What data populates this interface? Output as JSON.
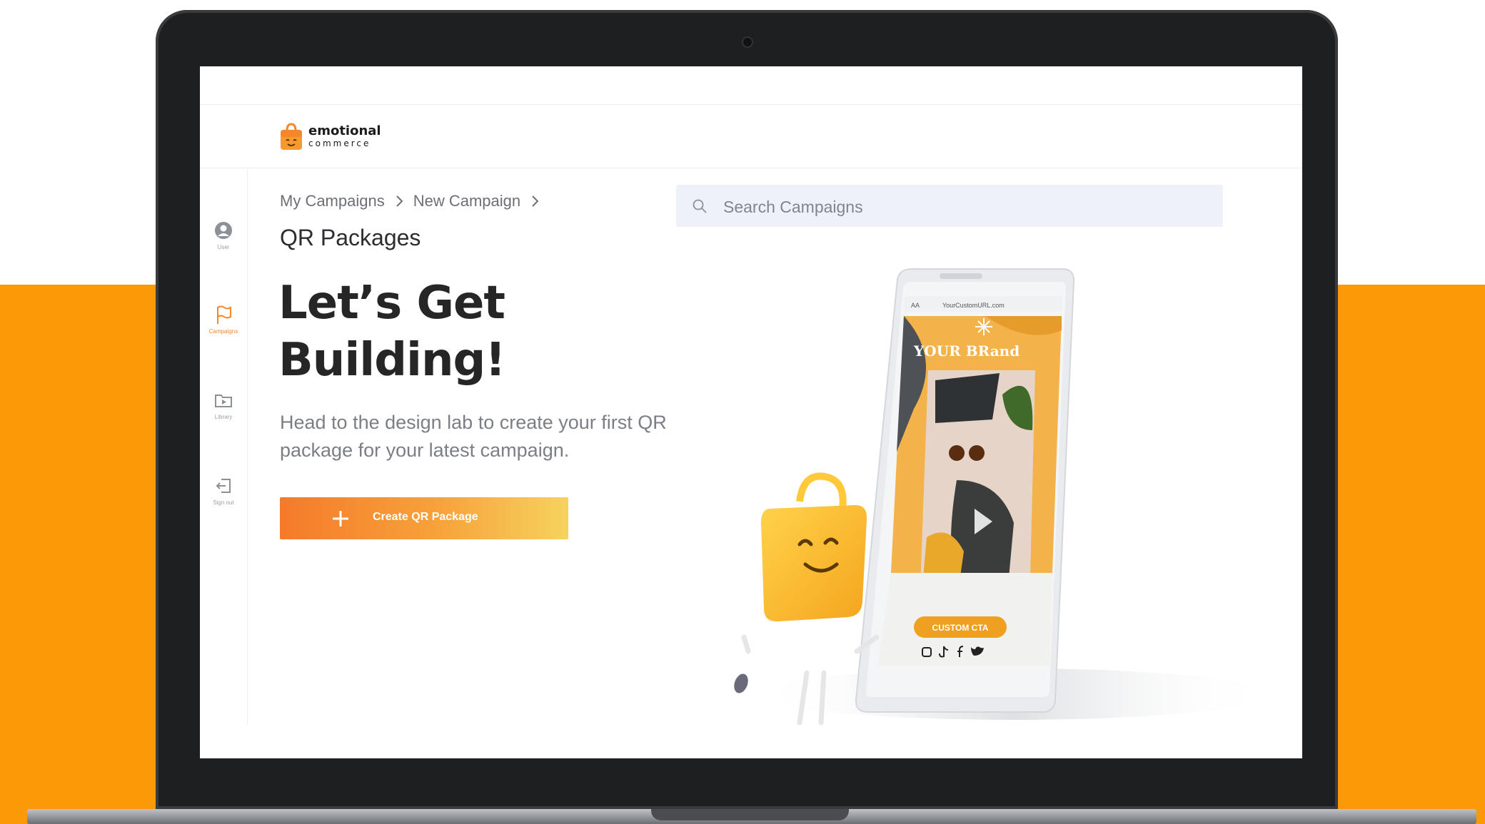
{
  "brand": {
    "name": "emotional",
    "tagline": "commerce"
  },
  "sidebar": {
    "items": [
      {
        "label": "User",
        "icon": "user-icon"
      },
      {
        "label": "Campaigns",
        "icon": "flag-icon"
      },
      {
        "label": "Library",
        "icon": "folder-play-icon"
      },
      {
        "label": "Sign out",
        "icon": "sign-out-icon"
      }
    ]
  },
  "breadcrumb": {
    "items": [
      "My Campaigns",
      "New Campaign"
    ]
  },
  "page": {
    "title": "QR Packages",
    "hero_line1": "Let’s Get",
    "hero_line2": "Building!",
    "description": "Head to the design lab to create your first QR package for your latest campaign.",
    "cta_label": "Create QR Package"
  },
  "search": {
    "placeholder": "Search Campaigns",
    "value": ""
  },
  "phone": {
    "url": "YourCustomURL.com",
    "text_size_label": "AA",
    "brand_text": "YOUR BRand",
    "cta_text": "CUSTOM CTA",
    "social_icons": [
      "instagram-icon",
      "tiktok-icon",
      "facebook-icon",
      "twitter-icon"
    ]
  },
  "colors": {
    "accent": "#f5872b",
    "background_band": "#fc9906",
    "cta_gradient_start": "#f57a2a",
    "cta_gradient_end": "#f6d35e",
    "search_bg": "#eef2f8"
  }
}
